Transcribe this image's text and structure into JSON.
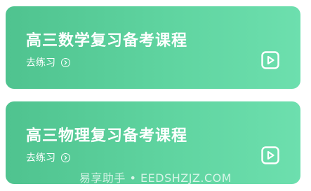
{
  "courses": [
    {
      "title": "高三数学复习备考课程",
      "action_label": "去练习",
      "action_icon": "chevron-right-circle-icon",
      "play_icon": "play-square-icon"
    },
    {
      "title": "高三物理复习备考课程",
      "action_label": "去练习",
      "action_icon": "chevron-right-circle-icon",
      "play_icon": "play-square-icon"
    }
  ],
  "watermark": "易享助手 • EEDSHZJZ.COM",
  "colors": {
    "card_start": "#4fc38f",
    "card_end": "#6ddfae",
    "text": "#ffffff"
  }
}
